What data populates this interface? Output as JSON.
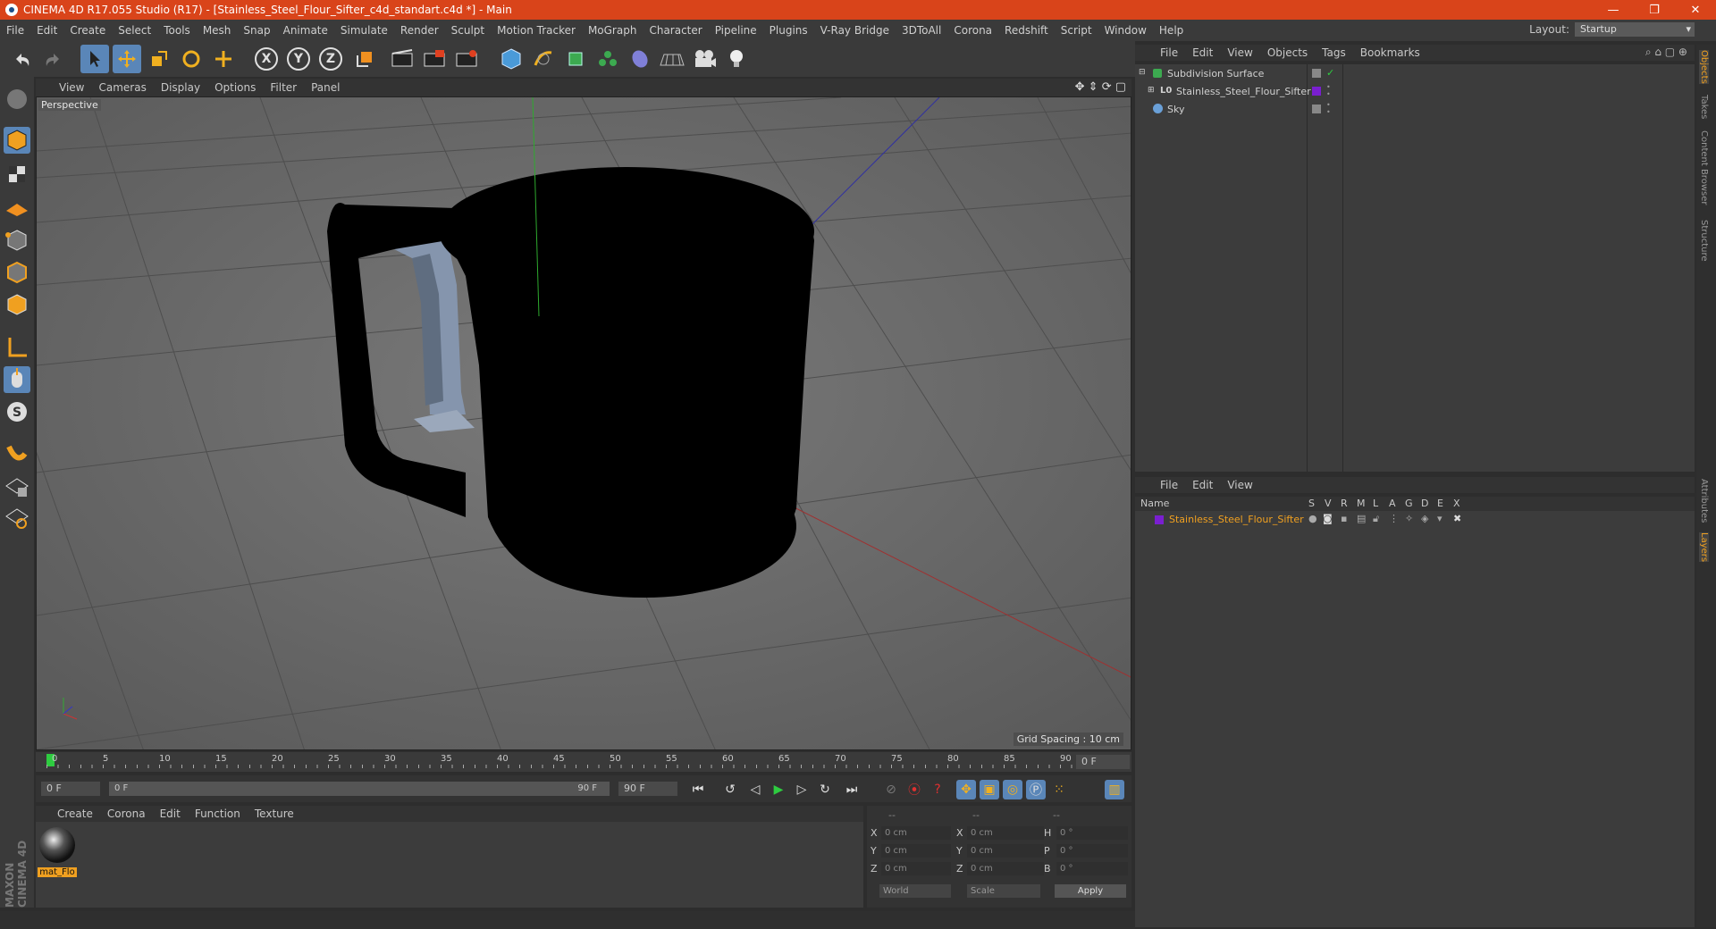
{
  "titlebar": {
    "title": "CINEMA 4D R17.055 Studio (R17) - [Stainless_Steel_Flour_Sifter_c4d_standart.c4d *] - Main",
    "minimize": "—",
    "maximize": "❐",
    "close": "✕"
  },
  "menubar": {
    "items": [
      "File",
      "Edit",
      "Create",
      "Select",
      "Tools",
      "Mesh",
      "Snap",
      "Animate",
      "Simulate",
      "Render",
      "Sculpt",
      "Motion Tracker",
      "MoGraph",
      "Character",
      "Pipeline",
      "Plugins",
      "V-Ray Bridge",
      "3DToAll",
      "Corona",
      "Redshift",
      "Script",
      "Window",
      "Help"
    ],
    "layout_label": "Layout:",
    "layout_value": "Startup"
  },
  "toolbar": {
    "x": "X",
    "y": "Y",
    "z": "Z"
  },
  "viewport": {
    "menu": [
      "View",
      "Cameras",
      "Display",
      "Options",
      "Filter",
      "Panel"
    ],
    "label": "Perspective",
    "grid_spacing": "Grid Spacing : 10 cm"
  },
  "timeline": {
    "ticks": [
      "0",
      "5",
      "10",
      "15",
      "20",
      "25",
      "30",
      "35",
      "40",
      "45",
      "50",
      "55",
      "60",
      "65",
      "70",
      "75",
      "80",
      "85",
      "90"
    ],
    "current_frame": "0 F",
    "start": "0 F",
    "range_start": "0 F",
    "range_end": "90 F",
    "end": "90 F"
  },
  "material": {
    "menu": [
      "Create",
      "Corona",
      "Edit",
      "Function",
      "Texture"
    ],
    "mat_name": "mat_Flo"
  },
  "coords": {
    "header": [
      "--",
      "--",
      "--"
    ],
    "rows": [
      {
        "a": "X",
        "av": "0 cm",
        "b": "X",
        "bv": "0 cm",
        "c": "H",
        "cv": "0 °"
      },
      {
        "a": "Y",
        "av": "0 cm",
        "b": "Y",
        "bv": "0 cm",
        "c": "P",
        "cv": "0 °"
      },
      {
        "a": "Z",
        "av": "0 cm",
        "b": "Z",
        "bv": "0 cm",
        "c": "B",
        "cv": "0 °"
      }
    ],
    "world": "World",
    "scale": "Scale",
    "apply": "Apply"
  },
  "objects": {
    "menu": [
      "File",
      "Edit",
      "View",
      "Objects",
      "Tags",
      "Bookmarks"
    ],
    "items": [
      "Subdivision Surface",
      "Stainless_Steel_Flour_Sifter",
      "Sky"
    ]
  },
  "layers": {
    "menu": [
      "File",
      "Edit",
      "View"
    ],
    "name_header": "Name",
    "cols": [
      "S",
      "V",
      "R",
      "M",
      "L",
      "A",
      "G",
      "D",
      "E",
      "X"
    ],
    "layer_name": "Stainless_Steel_Flour_Sifter",
    "layer_color": "#7a1fd0"
  },
  "sidetabs": [
    "Objects",
    "Takes",
    "Content Browser",
    "Structure",
    "Attributes",
    "Layers"
  ],
  "brand": "MAXON CINEMA 4D"
}
